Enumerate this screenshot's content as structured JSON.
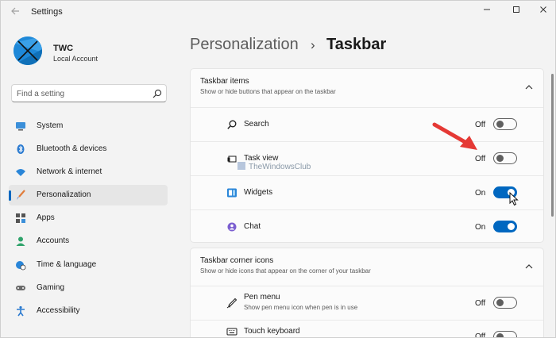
{
  "window": {
    "title": "Settings",
    "back_icon": "back-arrow-icon",
    "controls": [
      "minimize-icon",
      "maximize-icon",
      "close-icon"
    ]
  },
  "profile": {
    "name": "TWC",
    "account_type": "Local Account"
  },
  "search": {
    "placeholder": "Find a setting",
    "value": ""
  },
  "sidebar": {
    "items": [
      {
        "label": "System",
        "icon": "monitor-icon",
        "selected": false
      },
      {
        "label": "Bluetooth & devices",
        "icon": "bluetooth-icon",
        "selected": false
      },
      {
        "label": "Network & internet",
        "icon": "wifi-icon",
        "selected": false
      },
      {
        "label": "Personalization",
        "icon": "brush-icon",
        "selected": true
      },
      {
        "label": "Apps",
        "icon": "apps-icon",
        "selected": false
      },
      {
        "label": "Accounts",
        "icon": "person-icon",
        "selected": false
      },
      {
        "label": "Time & language",
        "icon": "globe-clock-icon",
        "selected": false
      },
      {
        "label": "Gaming",
        "icon": "controller-icon",
        "selected": false
      },
      {
        "label": "Accessibility",
        "icon": "accessibility-icon",
        "selected": false
      }
    ]
  },
  "breadcrumb": {
    "parent": "Personalization",
    "separator": "›",
    "current": "Taskbar"
  },
  "taskbar_items": {
    "title": "Taskbar items",
    "description": "Show or hide buttons that appear on the taskbar",
    "rows": [
      {
        "label": "Search",
        "icon": "search-icon",
        "state": "Off",
        "on": false
      },
      {
        "label": "Task view",
        "icon": "task-view-icon",
        "state": "Off",
        "on": false
      },
      {
        "label": "Widgets",
        "icon": "widgets-icon",
        "state": "On",
        "on": true
      },
      {
        "label": "Chat",
        "icon": "chat-icon",
        "state": "On",
        "on": true
      }
    ]
  },
  "corner_icons": {
    "title": "Taskbar corner icons",
    "description": "Show or hide icons that appear on the corner of your taskbar",
    "rows": [
      {
        "label": "Pen menu",
        "description": "Show pen menu icon when pen is in use",
        "icon": "pen-icon",
        "state": "Off",
        "on": false
      },
      {
        "label": "Touch keyboard",
        "icon": "keyboard-icon",
        "state": "Off",
        "on": false
      }
    ]
  },
  "watermark": "TheWindowsClub",
  "colors": {
    "accent": "#0067c0",
    "window_bg": "#f3f3f3",
    "card_bg": "#fbfbfb",
    "annotation_arrow": "#e53935"
  }
}
